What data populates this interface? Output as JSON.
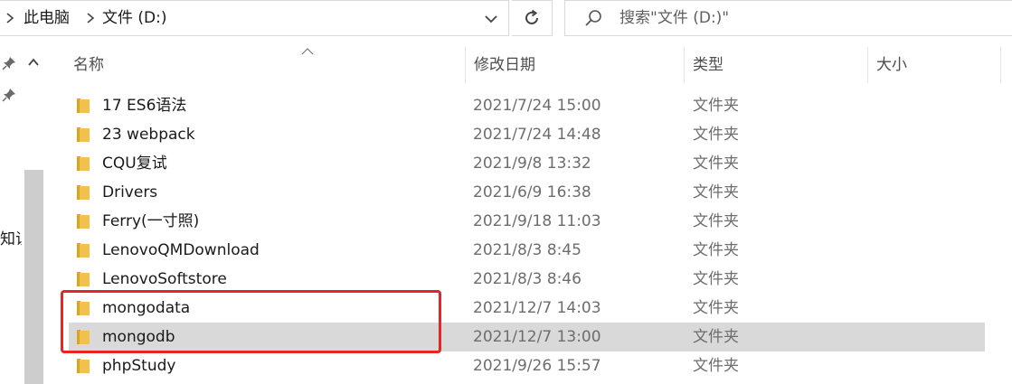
{
  "address": {
    "crumbs": [
      "此电脑",
      "文件 (D:)"
    ]
  },
  "search": {
    "placeholder": "搜索\"文件 (D:)\""
  },
  "nav": {
    "partial_label": "知识"
  },
  "columns": {
    "name": "名称",
    "date": "修改日期",
    "type": "类型",
    "size": "大小"
  },
  "files": [
    {
      "name": "17 ES6语法",
      "date": "2021/7/24 15:00",
      "type": "文件夹"
    },
    {
      "name": "23 webpack",
      "date": "2021/7/24 14:48",
      "type": "文件夹"
    },
    {
      "name": "CQU复试",
      "date": "2021/9/8 13:32",
      "type": "文件夹"
    },
    {
      "name": "Drivers",
      "date": "2021/6/9 16:38",
      "type": "文件夹"
    },
    {
      "name": "Ferry(一寸照)",
      "date": "2021/9/18 11:03",
      "type": "文件夹"
    },
    {
      "name": "LenovoQMDownload",
      "date": "2021/8/3 8:45",
      "type": "文件夹"
    },
    {
      "name": "LenovoSoftstore",
      "date": "2021/8/3 8:46",
      "type": "文件夹"
    },
    {
      "name": "mongodata",
      "date": "2021/12/7 14:03",
      "type": "文件夹"
    },
    {
      "name": "mongodb",
      "date": "2021/12/7 13:00",
      "type": "文件夹",
      "selected": true
    },
    {
      "name": "phpStudy",
      "date": "2021/9/26 15:57",
      "type": "文件夹"
    }
  ],
  "colors": {
    "selection": "#d9d9d9",
    "annotation": "#e52626",
    "folder": "#f0c24b"
  }
}
